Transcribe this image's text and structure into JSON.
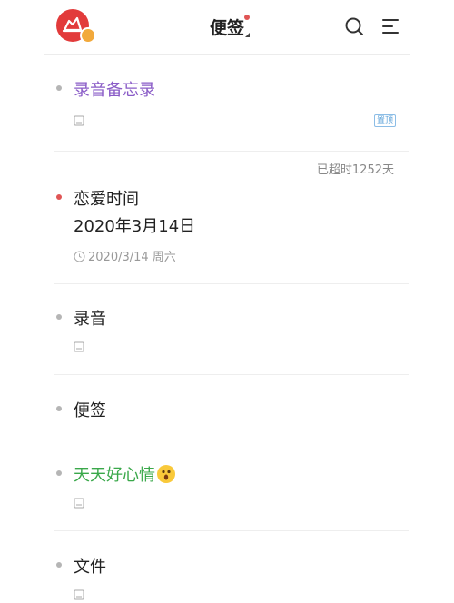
{
  "header": {
    "title": "便签"
  },
  "notes": [
    {
      "title": "录音备忘录",
      "title_color": "#8a5cc7",
      "bullet_color": "#b5b5b5",
      "pin_label": "置顶"
    },
    {
      "overdue_text": "已超时1252天",
      "title": "恋爱时间",
      "subtitle": "2020年3月14日",
      "bullet_color": "#e05555",
      "date": "2020/3/14 周六"
    },
    {
      "title": "录音",
      "bullet_color": "#b5b5b5"
    },
    {
      "title": "便签",
      "bullet_color": "#b5b5b5"
    },
    {
      "title": "天天好心情",
      "title_color": "#3aa84a",
      "emoji": "surprised-face-emoji",
      "bullet_color": "#b5b5b5"
    },
    {
      "title": "文件",
      "bullet_color": "#b5b5b5"
    }
  ],
  "icons": {
    "avatar": "app-avatar-icon",
    "search": "search-icon",
    "menu": "menu-icon",
    "attachment": "attachment-icon",
    "clock": "clock-icon"
  }
}
